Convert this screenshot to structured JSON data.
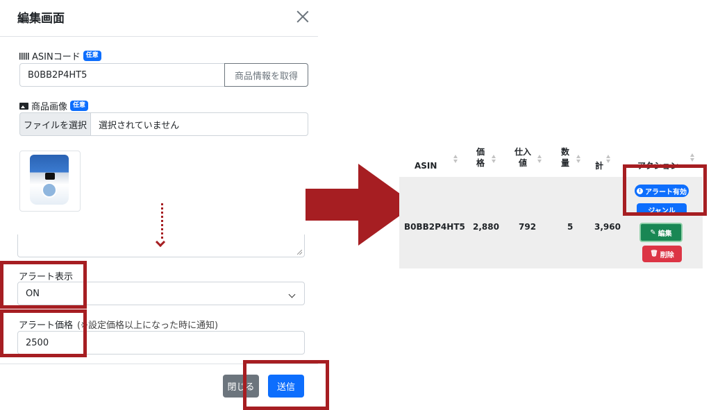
{
  "modal": {
    "title": "編集画面",
    "asin": {
      "label": "ASINコード",
      "badge": "任意",
      "value": "B0BB2P4HT5",
      "fetch_button": "商品情報を取得"
    },
    "image": {
      "label": "商品画像",
      "badge": "任意",
      "file_button": "ファイルを選択",
      "file_status": "選択されていません"
    },
    "alert_display": {
      "label": "アラート表示",
      "value": "ON"
    },
    "alert_price": {
      "label": "アラート価格",
      "note": "(※設定価格以上になった時に通知)",
      "value": "2500"
    },
    "footer": {
      "close_label": "閉じる",
      "submit_label": "送信"
    }
  },
  "table": {
    "headers": [
      "ASIN",
      "価\n格",
      "仕入\n値",
      "数\n量",
      "計",
      "アクション"
    ],
    "row": {
      "asin": "B0BB2P4HT5",
      "price": "2,880",
      "purchase": "792",
      "quantity": "5",
      "total": "3,960"
    },
    "actions": {
      "alert_badge": "アラート有効",
      "hidden_button": "ジャンル",
      "edit": "編集",
      "delete": "削除"
    }
  },
  "colors": {
    "annotation_red": "#a61e22",
    "primary": "#0d6efd",
    "success": "#198754",
    "danger": "#dc3545",
    "secondary": "#6c757d"
  }
}
